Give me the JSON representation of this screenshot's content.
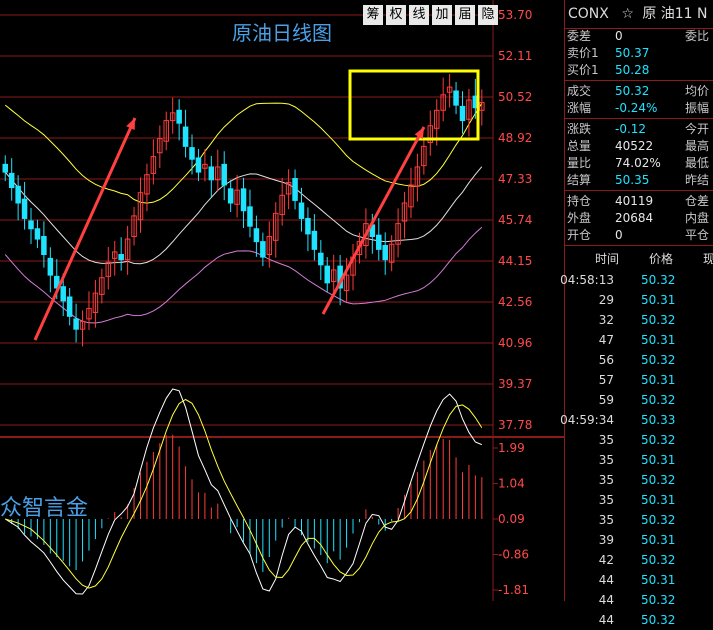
{
  "toolbar": {
    "buttons": [
      "筹",
      "权",
      "线",
      "加",
      "届",
      "隐"
    ]
  },
  "chart": {
    "title": "原油日线图",
    "watermark": "众智言金",
    "price_axis": [
      "53.70",
      "52.11",
      "50.52",
      "48.92",
      "47.33",
      "45.74",
      "44.15",
      "42.56",
      "40.96",
      "39.37",
      "37.78"
    ],
    "macd_axis": [
      "1.99",
      "1.04",
      "0.09",
      "-0.86",
      "-1.81"
    ],
    "colors": {
      "up": "#ff3b3b",
      "down": "#1fe3ff",
      "ma_short": "#e0e0e0",
      "ma_mid": "#ffff3b",
      "ma_long": "#d27bd6",
      "grid": "#8b1a1a",
      "highlight_box": "#ffff00",
      "arrow": "#ff4040"
    }
  },
  "quote": {
    "symbol": "CONX",
    "star": "☆",
    "name": "原 油11 N",
    "rows1": [
      {
        "label": "委差",
        "value": "0",
        "right": "委比",
        "color": "white"
      },
      {
        "label": "卖价1",
        "value": "50.37",
        "right": "",
        "color": "cyan"
      },
      {
        "label": "买价1",
        "value": "50.28",
        "right": "",
        "color": "cyan"
      }
    ],
    "rows2": [
      {
        "label": "成交",
        "value": "50.32",
        "right": "均价",
        "color": "cyan"
      },
      {
        "label": "涨幅",
        "value": "-0.24%",
        "right": "振幅",
        "color": "cyan"
      }
    ],
    "rows3": [
      {
        "label": "涨跌",
        "value": "-0.12",
        "right": "今开",
        "color": "cyan"
      },
      {
        "label": "总量",
        "value": "40522",
        "right": "最高",
        "color": "white"
      },
      {
        "label": "量比",
        "value": "74.02%",
        "right": "最低",
        "color": "white"
      },
      {
        "label": "结算",
        "value": "50.35",
        "right": "昨结",
        "color": "cyan"
      }
    ],
    "rows4": [
      {
        "label": "持仓",
        "value": "40119",
        "right": "仓差",
        "color": "white"
      },
      {
        "label": "外盘",
        "value": "20684",
        "right": "内盘",
        "color": "white"
      },
      {
        "label": "开仓",
        "value": "0",
        "right": "平仓",
        "color": "white"
      }
    ],
    "tick_header": {
      "time": "时间",
      "price": "价格",
      "vol": "现"
    },
    "ticks": [
      {
        "time": "04:58:13",
        "price": "50.32"
      },
      {
        "time": "29",
        "price": "50.31"
      },
      {
        "time": "32",
        "price": "50.32"
      },
      {
        "time": "47",
        "price": "50.31"
      },
      {
        "time": "56",
        "price": "50.32"
      },
      {
        "time": "57",
        "price": "50.31"
      },
      {
        "time": "59",
        "price": "50.32"
      },
      {
        "time": "04:59:34",
        "price": "50.33"
      },
      {
        "time": "35",
        "price": "50.32"
      },
      {
        "time": "35",
        "price": "50.31"
      },
      {
        "time": "35",
        "price": "50.32"
      },
      {
        "time": "35",
        "price": "50.31"
      },
      {
        "time": "35",
        "price": "50.32"
      },
      {
        "time": "39",
        "price": "50.31"
      },
      {
        "time": "42",
        "price": "50.32"
      },
      {
        "time": "44",
        "price": "50.31"
      },
      {
        "time": "44",
        "price": "50.32"
      },
      {
        "time": "44",
        "price": "50.32"
      }
    ]
  }
}
